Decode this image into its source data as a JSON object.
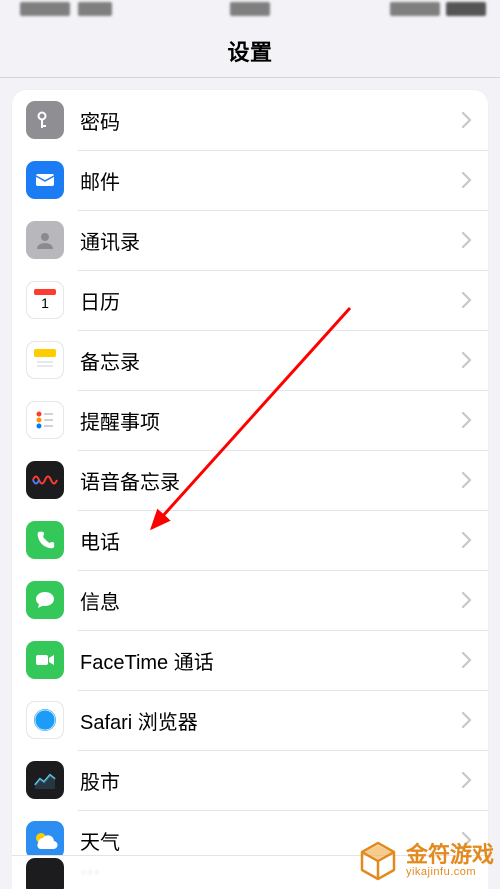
{
  "header": {
    "title": "设置"
  },
  "rows": [
    {
      "id": "passwords",
      "label": "密码",
      "icon_bg": "#8e8e93"
    },
    {
      "id": "mail",
      "label": "邮件",
      "icon_bg": "#1c7cf4"
    },
    {
      "id": "contacts",
      "label": "通讯录",
      "icon_bg": "#b7b7bc"
    },
    {
      "id": "calendar",
      "label": "日历",
      "icon_bg": "#ffffff"
    },
    {
      "id": "notes",
      "label": "备忘录",
      "icon_bg": "#ffffff"
    },
    {
      "id": "reminders",
      "label": "提醒事项",
      "icon_bg": "#ffffff"
    },
    {
      "id": "voice-memos",
      "label": "语音备忘录",
      "icon_bg": "#1c1c1e"
    },
    {
      "id": "phone",
      "label": "电话",
      "icon_bg": "#34c759"
    },
    {
      "id": "messages",
      "label": "信息",
      "icon_bg": "#34c759"
    },
    {
      "id": "facetime",
      "label": "FaceTime 通话",
      "icon_bg": "#34c759"
    },
    {
      "id": "safari",
      "label": "Safari 浏览器",
      "icon_bg": "#ffffff"
    },
    {
      "id": "stocks",
      "label": "股市",
      "icon_bg": "#1c1c1e"
    },
    {
      "id": "weather",
      "label": "天气",
      "icon_bg": "#2b8ef0"
    }
  ],
  "watermark": {
    "line1": "金符游戏",
    "line2": "yikajinfu.com"
  },
  "annotation": {
    "target_row": "phone"
  }
}
